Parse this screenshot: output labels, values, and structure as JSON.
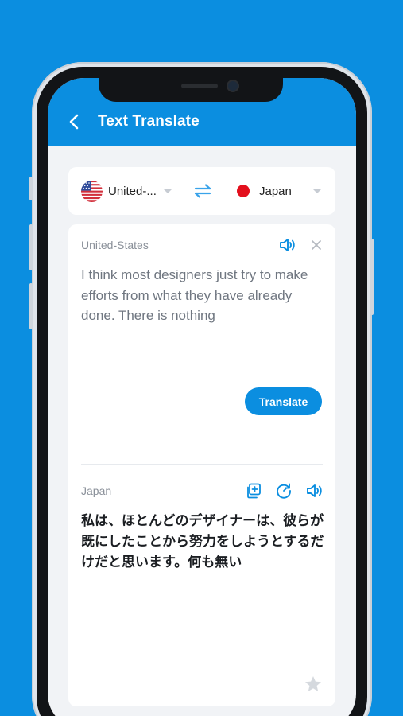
{
  "header": {
    "title": "Text Translate",
    "back_icon": "chevron-left-icon"
  },
  "language_bar": {
    "from": {
      "name": "United-...",
      "flag": "us-flag-icon"
    },
    "swap_icon": "swap-arrows-icon",
    "to": {
      "name": "Japan",
      "flag": "japan-flag-icon"
    }
  },
  "source": {
    "language_label": "United-States",
    "text": "I think most designers just try to make efforts from what they have already done. There is nothing",
    "icons": [
      "speaker-icon",
      "close-icon"
    ]
  },
  "translate_button": {
    "label": "Translate"
  },
  "target": {
    "language_label": "Japan",
    "text": "私は、ほとんどのデザイナーは、彼らが既にしたことから努力をしようとするだけだと思います。何も無い",
    "icons": [
      "copy-icon",
      "refresh-icon",
      "speaker-icon",
      "star-icon"
    ]
  },
  "colors": {
    "accent": "#0b8ee0",
    "background": "#f1f3f6",
    "card": "#ffffff",
    "muted_text": "#8a9099",
    "source_text": "#6f7680",
    "japan_red": "#e3101d"
  }
}
